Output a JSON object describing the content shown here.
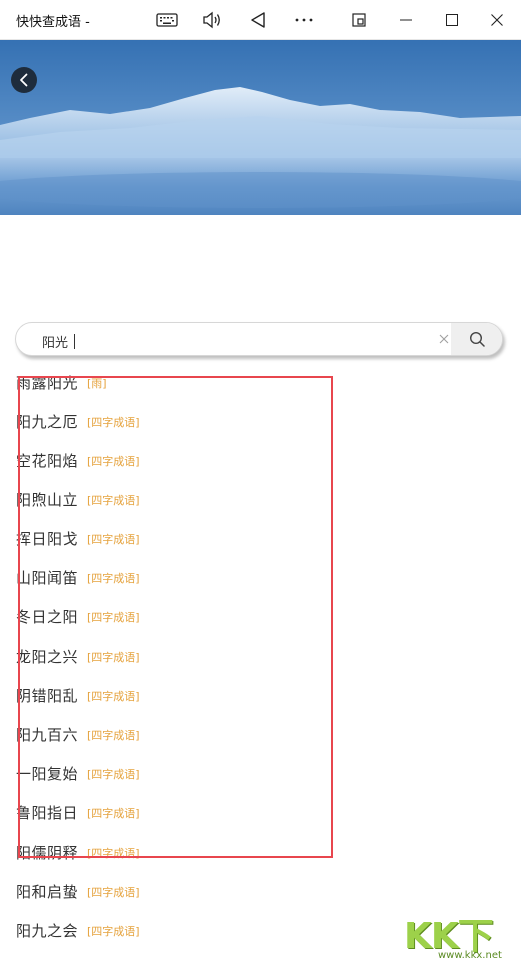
{
  "window": {
    "title": "快快查成语 -"
  },
  "search": {
    "value": "阳光"
  },
  "results": [
    {
      "idiom": "雨露阳光",
      "tag": "[雨]"
    },
    {
      "idiom": "阳九之厄",
      "tag": "[四字成语]"
    },
    {
      "idiom": "空花阳焰",
      "tag": "[四字成语]"
    },
    {
      "idiom": "阳煦山立",
      "tag": "[四字成语]"
    },
    {
      "idiom": "挥日阳戈",
      "tag": "[四字成语]"
    },
    {
      "idiom": "山阳闻笛",
      "tag": "[四字成语]"
    },
    {
      "idiom": "冬日之阳",
      "tag": "[四字成语]"
    },
    {
      "idiom": "龙阳之兴",
      "tag": "[四字成语]"
    },
    {
      "idiom": "阴错阳乱",
      "tag": "[四字成语]"
    },
    {
      "idiom": "阳九百六",
      "tag": "[四字成语]"
    },
    {
      "idiom": "一阳复始",
      "tag": "[四字成语]"
    },
    {
      "idiom": "鲁阳指日",
      "tag": "[四字成语]"
    },
    {
      "idiom": "阳儒阴释",
      "tag": "[四字成语]"
    },
    {
      "idiom": "阳和启蛰",
      "tag": "[四字成语]"
    },
    {
      "idiom": "阳九之会",
      "tag": "[四字成语]"
    }
  ],
  "watermark": {
    "main": "KK下载",
    "sub": "www.kkx.net"
  },
  "colors": {
    "tag": "#e5a23c",
    "highlight": "#e8464e",
    "banner": "#5b93cc"
  },
  "icons": [
    "keyboard-icon",
    "speaker-icon",
    "back-triangle-icon",
    "more-icon",
    "snap-icon",
    "minimize-icon",
    "maximize-icon",
    "close-icon",
    "back-arrow-icon",
    "clear-icon",
    "search-icon"
  ]
}
